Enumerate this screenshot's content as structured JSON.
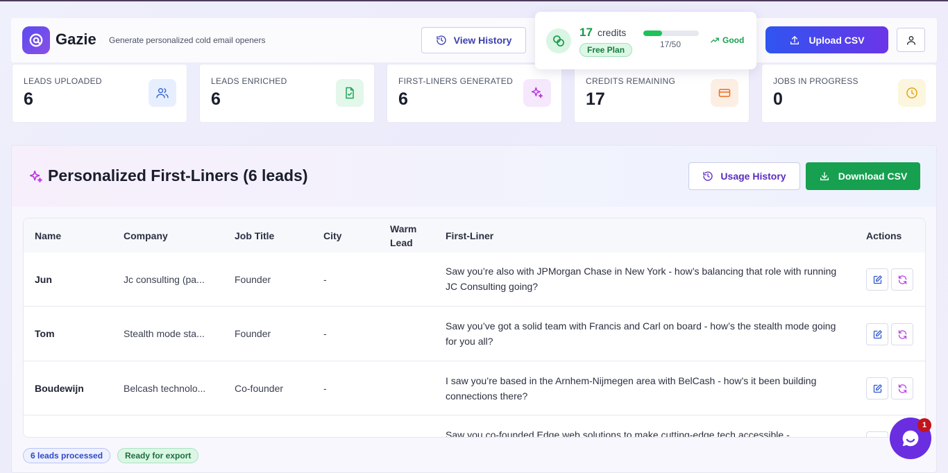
{
  "app": {
    "name": "Gazie",
    "tagline": "Generate personalized cold email openers"
  },
  "header": {
    "view_history_label": "View History",
    "upload_label": "Upload CSV",
    "credits": {
      "value": "17",
      "word": "credits",
      "plan": "Free Plan",
      "usage_text": "17/50",
      "usage_fraction": 0.34,
      "status": "Good"
    }
  },
  "stats": [
    {
      "label": "LEADS UPLOADED",
      "value": "6",
      "icon": "users-icon",
      "color": "#3b6ad6"
    },
    {
      "label": "LEADS ENRICHED",
      "value": "6",
      "icon": "file-check-icon",
      "color": "#1ea65a"
    },
    {
      "label": "FIRST-LINERS GENERATED",
      "value": "6",
      "icon": "sparkles-icon",
      "color": "#b935e0"
    },
    {
      "label": "CREDITS REMAINING",
      "value": "17",
      "icon": "credit-card-icon",
      "color": "#ef6a1c"
    },
    {
      "label": "JOBS IN PROGRESS",
      "value": "0",
      "icon": "clock-icon",
      "color": "#e2a515"
    }
  ],
  "panel": {
    "title": "Personalized First-Liners (6 leads)",
    "usage_history_label": "Usage History",
    "download_label": "Download CSV"
  },
  "table": {
    "headers": {
      "name": "Name",
      "company": "Company",
      "job_title": "Job Title",
      "city": "City",
      "warm_lead_1": "Warm",
      "warm_lead_2": "Lead",
      "first_liner": "First-Liner",
      "actions": "Actions"
    },
    "rows": [
      {
        "name": "Jun",
        "company": "Jc consulting (pa...",
        "job_title": "Founder",
        "city": "-",
        "first_liner": "Saw you’re also with JPMorgan Chase in New York - how’s balancing that role with running JC Consulting going?"
      },
      {
        "name": "Tom",
        "company": "Stealth mode sta...",
        "job_title": "Founder",
        "city": "-",
        "first_liner": "Saw you’ve got a solid team with Francis and Carl on board - how’s the stealth mode going for you all?"
      },
      {
        "name": "Boudewijn",
        "company": "Belcash technolo...",
        "job_title": "Co-founder",
        "city": "-",
        "first_liner": "I saw you’re based in the Arnhem-Nijmegen area with BelCash - how’s it been building connections there?"
      },
      {
        "name": "",
        "company": "",
        "job_title": "",
        "city": "",
        "first_liner": "Saw you co-founded Edge web solutions to make cutting-edge tech accessible -"
      }
    ]
  },
  "footer": {
    "badge_processed": "6 leads processed",
    "badge_ready": "Ready for export"
  },
  "chat": {
    "notification_count": "1"
  }
}
